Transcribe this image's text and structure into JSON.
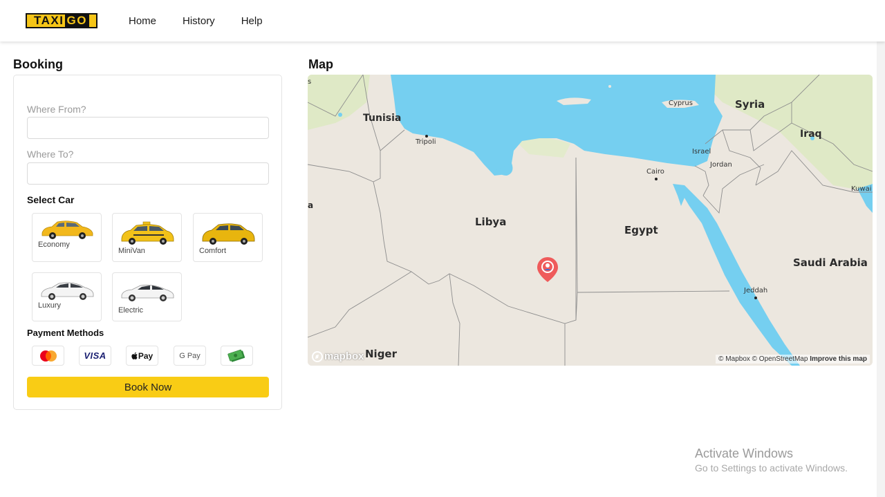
{
  "header": {
    "logo": {
      "taxi": "TAXI",
      "go": "GO"
    },
    "nav": [
      "Home",
      "History",
      "Help"
    ]
  },
  "booking": {
    "title": "Booking",
    "from_label": "Where From?",
    "from_value": "",
    "to_label": "Where To?",
    "to_value": "",
    "select_car_label": "Select Car",
    "cars": [
      {
        "label": "Economy",
        "color": "#f2b81c"
      },
      {
        "label": "MiniVan",
        "color": "#f2c21a"
      },
      {
        "label": "Comfort",
        "color": "#e8b50e"
      },
      {
        "label": "Luxury",
        "color": "#f4f4f4"
      },
      {
        "label": "Electric",
        "color": "#f4f4f4"
      }
    ],
    "payment_label": "Payment Methods",
    "payments": [
      "mastercard-icon",
      "VISA",
      "Pay",
      "G Pay",
      "cash-icon"
    ],
    "book_button": "Book Now"
  },
  "map": {
    "title": "Map",
    "labels": {
      "tunisia": "Tunisia",
      "tripoli": "Tripoli",
      "cyprus": "Cyprus",
      "syria": "Syria",
      "iraq": "Iraq",
      "israel": "Israel",
      "jordan": "Jordan",
      "cairo": "Cairo",
      "kuwait": "Kuwai",
      "libya": "Libya",
      "egypt": "Egypt",
      "saudi": "Saudi Arabia",
      "jeddah": "Jeddah",
      "niger": "Niger",
      "edge_s": "s",
      "edge_a": "a"
    },
    "mapbox": "mapbox",
    "attribution": "© Mapbox © OpenStreetMap",
    "improve": "Improve this map",
    "colors": {
      "water": "#75cff0",
      "land": "#ece7df",
      "green": "#dfe9c6"
    }
  },
  "watermark": {
    "title": "Activate Windows",
    "subtitle": "Go to Settings to activate Windows."
  }
}
